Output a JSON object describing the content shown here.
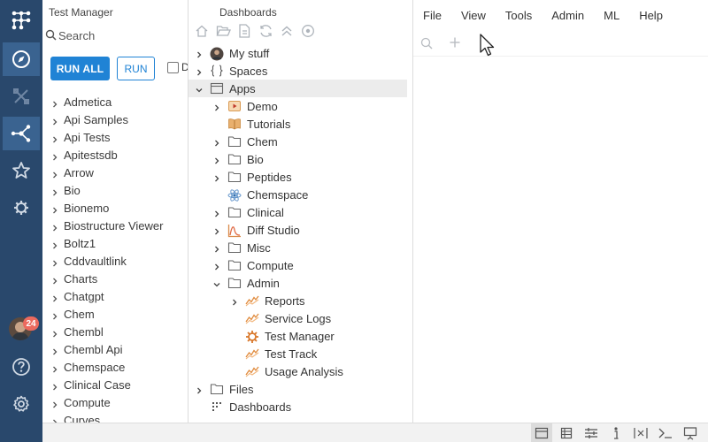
{
  "app": {
    "notification_count": "24",
    "accent_color": "#2083d5",
    "rail_color": "#29486c"
  },
  "rail": {
    "items": [
      {
        "icon": "datagrok-logo-icon"
      },
      {
        "icon": "compass-icon",
        "active": true
      },
      {
        "icon": "pencil-ruler-icon"
      },
      {
        "icon": "network-icon",
        "active": true
      },
      {
        "icon": "star-icon"
      },
      {
        "icon": "gear-bug-icon"
      },
      {
        "icon": "help-icon"
      },
      {
        "icon": "settings-icon"
      }
    ]
  },
  "test_manager": {
    "title": "Test Manager",
    "search_placeholder": "Search",
    "run_all_label": "RUN ALL",
    "run_label": "RUN",
    "checkbox_label": "D",
    "packages": [
      "Admetica",
      "Api Samples",
      "Api Tests",
      "Apitestsdb",
      "Arrow",
      "Bio",
      "Bionemo",
      "Biostructure Viewer",
      "Boltz1",
      "Cddvaultlink",
      "Charts",
      "Chatgpt",
      "Chem",
      "Chembl",
      "Chembl Api",
      "Chemspace",
      "Clinical Case",
      "Compute",
      "Curves"
    ]
  },
  "dashboards": {
    "title": "Dashboards",
    "toolbar": [
      "home-icon",
      "open-folder-icon",
      "file-icon",
      "refresh-icon",
      "collapse-all-icon",
      "target-icon"
    ],
    "tree": [
      {
        "label": "My stuff",
        "icon": "user-avatar-icon",
        "depth": 0,
        "chevron": "right"
      },
      {
        "label": "Spaces",
        "icon": "braces-icon",
        "depth": 0,
        "chevron": "right"
      },
      {
        "label": "Apps",
        "icon": "window-icon",
        "depth": 0,
        "chevron": "down",
        "selected": true
      },
      {
        "label": "Demo",
        "icon": "demo-icon",
        "depth": 1,
        "chevron": "right"
      },
      {
        "label": "Tutorials",
        "icon": "book-icon",
        "depth": 1,
        "chevron": ""
      },
      {
        "label": "Chem",
        "icon": "folder-icon",
        "depth": 1,
        "chevron": "right"
      },
      {
        "label": "Bio",
        "icon": "folder-icon",
        "depth": 1,
        "chevron": "right"
      },
      {
        "label": "Peptides",
        "icon": "folder-icon",
        "depth": 1,
        "chevron": "right"
      },
      {
        "label": "Chemspace",
        "icon": "atom-icon",
        "depth": 1,
        "chevron": ""
      },
      {
        "label": "Clinical",
        "icon": "folder-icon",
        "depth": 1,
        "chevron": "right"
      },
      {
        "label": "Diff Studio",
        "icon": "diff-studio-icon",
        "depth": 1,
        "chevron": "right"
      },
      {
        "label": "Misc",
        "icon": "folder-icon",
        "depth": 1,
        "chevron": "right"
      },
      {
        "label": "Compute",
        "icon": "folder-icon",
        "depth": 1,
        "chevron": "right"
      },
      {
        "label": "Admin",
        "icon": "folder-icon",
        "depth": 1,
        "chevron": "down"
      },
      {
        "label": "Reports",
        "icon": "trend-icon",
        "depth": 2,
        "chevron": "right"
      },
      {
        "label": "Service Logs",
        "icon": "trend-icon",
        "depth": 2,
        "chevron": ""
      },
      {
        "label": "Test Manager",
        "icon": "gear-bug-icon",
        "depth": 2,
        "chevron": ""
      },
      {
        "label": "Test Track",
        "icon": "trend-icon",
        "depth": 2,
        "chevron": ""
      },
      {
        "label": "Usage Analysis",
        "icon": "trend-icon",
        "depth": 2,
        "chevron": ""
      },
      {
        "label": "Files",
        "icon": "folder-icon",
        "depth": 0,
        "chevron": "right"
      },
      {
        "label": "Dashboards",
        "icon": "dots-grid-icon",
        "depth": 0,
        "chevron": ""
      }
    ]
  },
  "menu": {
    "items": [
      "File",
      "View",
      "Tools",
      "Admin",
      "ML",
      "Help"
    ]
  },
  "main_toolbar": [
    "search-icon",
    "plus-icon"
  ],
  "status_bar": [
    "layout-icon",
    "properties-icon",
    "sliders-icon",
    "info-icon",
    "variables-icon",
    "console-icon",
    "presentation-icon"
  ]
}
